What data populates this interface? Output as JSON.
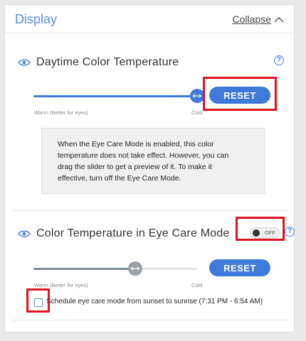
{
  "header": {
    "title": "Display",
    "collapse_label": "Collapse"
  },
  "daytime": {
    "title": "Daytime Color Temperature",
    "help": "?",
    "slider": {
      "value_fraction": 1.0,
      "min_label": "Warm (Better for eyes)",
      "max_label": "Cold"
    },
    "reset_label": "RESET",
    "info_lines": [
      "When the Eye Care Mode is enabled, this color",
      "temperature does not take effect. However, you can",
      "drag the slider to get a preview of it. To make it",
      "effective, turn off the Eye Care Mode."
    ]
  },
  "eyecare": {
    "title": "Color Temperature in Eye Care Mode",
    "help": "?",
    "toggle_label": "OFF",
    "slider": {
      "value_fraction": 0.62,
      "min_label": "Warm (Better for eyes)",
      "max_label": "Cold"
    },
    "reset_label": "RESET",
    "schedule_label": "Schedule eye care mode from sunset to sunrise (7:31 PM - 6:54 AM)",
    "schedule_checked": false
  },
  "colors": {
    "accent": "#3f79d9",
    "highlight": "#e0131f",
    "slider_fill_active": "#3f79d9",
    "slider_fill_eyecare": "#7f8a9a"
  },
  "icons": [
    "eye-icon",
    "help-icon",
    "chevron-up-icon",
    "resize-horizontal-icon"
  ]
}
